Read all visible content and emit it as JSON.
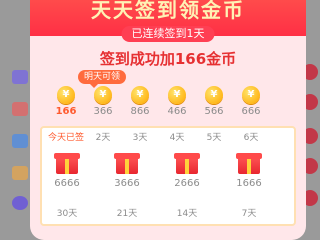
{
  "modal": {
    "title": "天天签到领金币",
    "streak_badge": "已连续签到1天",
    "headline": "签到成功加166金币",
    "tomorrow_tag": "明天可领"
  },
  "coins": [
    {
      "value": "166",
      "active": true
    },
    {
      "value": "366"
    },
    {
      "value": "866"
    },
    {
      "value": "466"
    },
    {
      "value": "566"
    },
    {
      "value": "666"
    }
  ],
  "days": [
    "今天已签",
    "2天",
    "3天",
    "4天",
    "5天",
    "6天"
  ],
  "gifts": [
    {
      "value": "6666",
      "days": "30天",
      "active": false
    },
    {
      "value": "3666",
      "days": "21天"
    },
    {
      "value": "2666",
      "days": "14天"
    },
    {
      "value": "1666",
      "days": "7天"
    }
  ],
  "colors": {
    "accent": "#ff3f53",
    "gold": "#ffb81c"
  }
}
